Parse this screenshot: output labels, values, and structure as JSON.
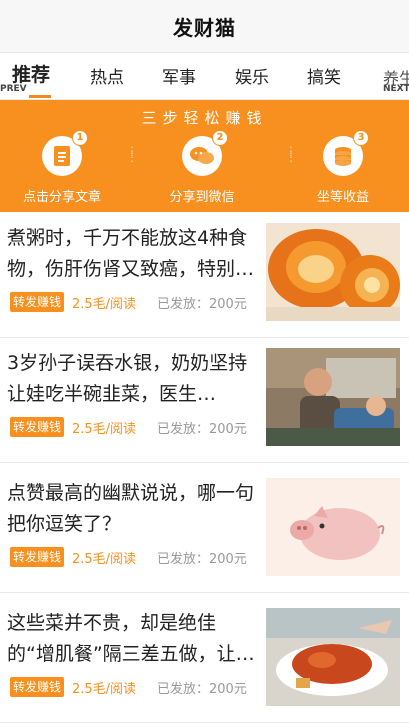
{
  "app": {
    "title": "发财猫"
  },
  "tabs": {
    "prev_label": "PREV",
    "next_label": "NEXT",
    "items": [
      "推荐",
      "热点",
      "军事",
      "娱乐",
      "搞笑"
    ],
    "partial": "养生"
  },
  "banner": {
    "headline": "三步轻松赚钱",
    "steps": [
      {
        "num": "1",
        "label": "点击分享文章",
        "icon": "document-icon"
      },
      {
        "num": "2",
        "label": "分享到微信",
        "icon": "wechat-icon"
      },
      {
        "num": "3",
        "label": "坐等收益",
        "icon": "coins-icon"
      }
    ]
  },
  "articles": [
    {
      "title": "煮粥时，千万不能放这4种食物，伤肝伤肾又致癌，特别…",
      "tag": "转发赚钱",
      "rate": "2.5毛/阅读",
      "sent": "已发放：200元",
      "thumb": "pumpkin"
    },
    {
      "title": "3岁孙子误吞水银，奶奶坚持让娃吃半碗韭菜，医生…",
      "tag": "转发赚钱",
      "rate": "2.5毛/阅读",
      "sent": "已发放：200元",
      "thumb": "elderly-woman"
    },
    {
      "title": "点赞最高的幽默说说，哪一句把你逗笑了？",
      "tag": "转发赚钱",
      "rate": "2.5毛/阅读",
      "sent": "已发放：200元",
      "thumb": "pig-cartoon"
    },
    {
      "title": "这些菜并不贵，却是绝佳的“增肌餐”隔三差五做，让…",
      "tag": "转发赚钱",
      "rate": "2.5毛/阅读",
      "sent": "已发放：200元",
      "thumb": "cooked-crab"
    }
  ],
  "colors": {
    "accent": "#f7901e",
    "header_bg": "#f7f7f7"
  }
}
